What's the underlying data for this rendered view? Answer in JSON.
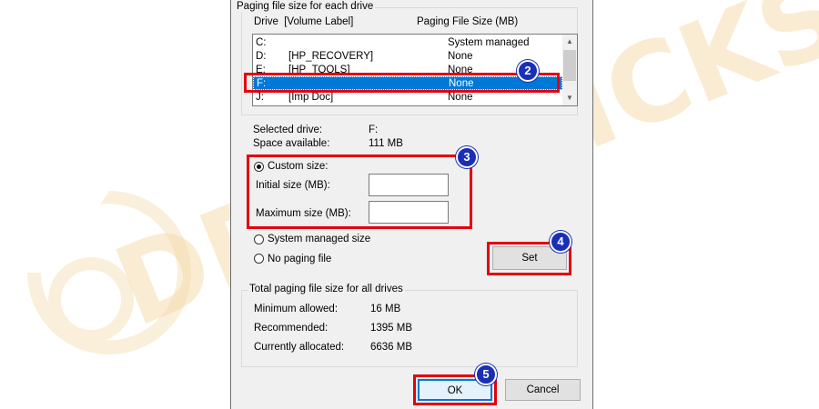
{
  "paging_group": {
    "title": "Paging file size for each drive",
    "col_drive": "Drive  [Volume Label]",
    "col_size": "Paging File Size (MB)",
    "drives": [
      {
        "drive": "C:",
        "label": "",
        "size": "System managed"
      },
      {
        "drive": "D:",
        "label": "[HP_RECOVERY]",
        "size": "None"
      },
      {
        "drive": "E:",
        "label": "[HP_TOOLS]",
        "size": "None"
      },
      {
        "drive": "F:",
        "label": "",
        "size": "None"
      },
      {
        "drive": "J:",
        "label": "[Imp Doc]",
        "size": "None"
      }
    ]
  },
  "selected": {
    "drive_label": "Selected drive:",
    "drive_value": "F:",
    "space_label": "Space available:",
    "space_value": "111 MB"
  },
  "options": {
    "custom_size": "Custom size:",
    "initial_size": "Initial size (MB):",
    "initial_value": "",
    "maximum_size": "Maximum size (MB):",
    "maximum_value": "",
    "system_managed": "System managed size",
    "no_paging": "No paging file",
    "set_button": "Set"
  },
  "totals": {
    "title": "Total paging file size for all drives",
    "min_label": "Minimum allowed:",
    "min_value": "16 MB",
    "rec_label": "Recommended:",
    "rec_value": "1395 MB",
    "cur_label": "Currently allocated:",
    "cur_value": "6636 MB"
  },
  "buttons": {
    "ok": "OK",
    "cancel": "Cancel"
  },
  "annotations": {
    "step2": "2",
    "step3": "3",
    "step4": "4",
    "step5": "5"
  },
  "colors": {
    "highlight": "#0078d7",
    "annotation_red": "#e3000f",
    "badge_blue": "#1a2fb5",
    "watermark": "#f3d9a6"
  }
}
